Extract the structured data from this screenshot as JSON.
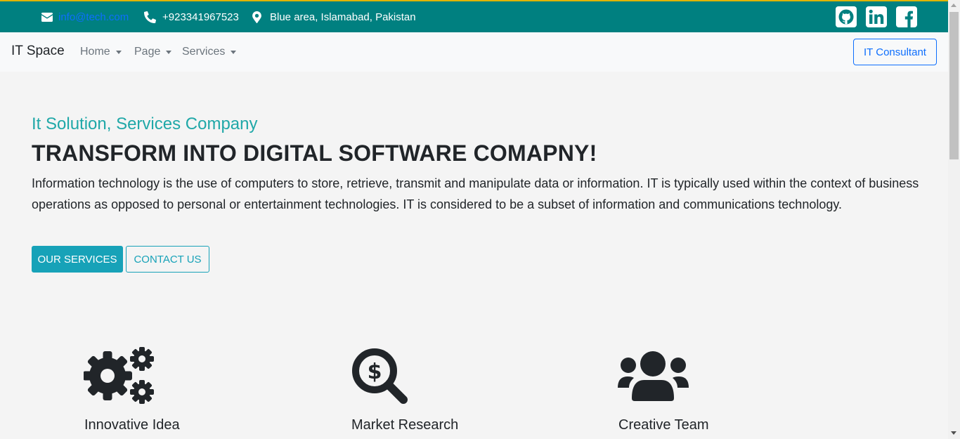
{
  "topbar": {
    "email": "info@tech.com",
    "phone": "+923341967523",
    "address": "Blue area, Islamabad, Pakistan",
    "icons": [
      "envelope-icon",
      "phone-icon",
      "location-pin-icon"
    ],
    "social": [
      "github-icon",
      "linkedin-icon",
      "facebook-icon"
    ],
    "background": "#008080"
  },
  "navbar": {
    "brand": "IT Space",
    "links": [
      {
        "label": "Home"
      },
      {
        "label": "Page"
      },
      {
        "label": "Services"
      }
    ],
    "cta": "IT Consultant"
  },
  "hero": {
    "subtitle": "It Solution, Services Company",
    "title": "TRANSFORM INTO DIGITAL SOFTWARE COMAPNY!",
    "text": "Information technology is the use of computers to store, retrieve, transmit and manipulate data or information. IT is typically used within the context of business operations as opposed to personal or entertainment technologies. IT is considered to be a subset of information and communications technology.",
    "primary_button": "OUR SERVICES",
    "secondary_button": "CONTACT US",
    "accent": "#17a2b8"
  },
  "features": [
    {
      "title": "Innovative Idea",
      "icon": "gears-icon"
    },
    {
      "title": "Market Research",
      "icon": "search-dollar-icon"
    },
    {
      "title": "Creative Team",
      "icon": "users-icon"
    }
  ]
}
